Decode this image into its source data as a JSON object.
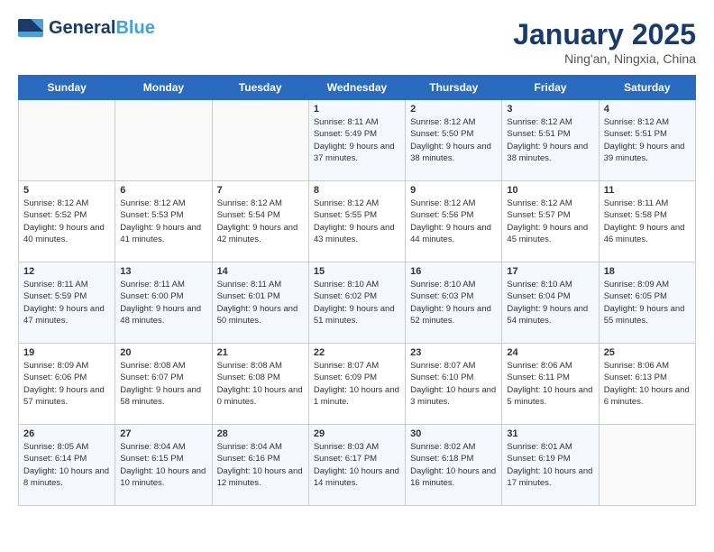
{
  "logo": {
    "brand1": "General",
    "brand2": "Blue",
    "icon": "▶"
  },
  "title": "January 2025",
  "subtitle": "Ning'an, Ningxia, China",
  "days_of_week": [
    "Sunday",
    "Monday",
    "Tuesday",
    "Wednesday",
    "Thursday",
    "Friday",
    "Saturday"
  ],
  "weeks": [
    [
      {
        "day": "",
        "info": ""
      },
      {
        "day": "",
        "info": ""
      },
      {
        "day": "",
        "info": ""
      },
      {
        "day": "1",
        "info": "Sunrise: 8:11 AM\nSunset: 5:49 PM\nDaylight: 9 hours and 37 minutes."
      },
      {
        "day": "2",
        "info": "Sunrise: 8:12 AM\nSunset: 5:50 PM\nDaylight: 9 hours and 38 minutes."
      },
      {
        "day": "3",
        "info": "Sunrise: 8:12 AM\nSunset: 5:51 PM\nDaylight: 9 hours and 38 minutes."
      },
      {
        "day": "4",
        "info": "Sunrise: 8:12 AM\nSunset: 5:51 PM\nDaylight: 9 hours and 39 minutes."
      }
    ],
    [
      {
        "day": "5",
        "info": "Sunrise: 8:12 AM\nSunset: 5:52 PM\nDaylight: 9 hours and 40 minutes."
      },
      {
        "day": "6",
        "info": "Sunrise: 8:12 AM\nSunset: 5:53 PM\nDaylight: 9 hours and 41 minutes."
      },
      {
        "day": "7",
        "info": "Sunrise: 8:12 AM\nSunset: 5:54 PM\nDaylight: 9 hours and 42 minutes."
      },
      {
        "day": "8",
        "info": "Sunrise: 8:12 AM\nSunset: 5:55 PM\nDaylight: 9 hours and 43 minutes."
      },
      {
        "day": "9",
        "info": "Sunrise: 8:12 AM\nSunset: 5:56 PM\nDaylight: 9 hours and 44 minutes."
      },
      {
        "day": "10",
        "info": "Sunrise: 8:12 AM\nSunset: 5:57 PM\nDaylight: 9 hours and 45 minutes."
      },
      {
        "day": "11",
        "info": "Sunrise: 8:11 AM\nSunset: 5:58 PM\nDaylight: 9 hours and 46 minutes."
      }
    ],
    [
      {
        "day": "12",
        "info": "Sunrise: 8:11 AM\nSunset: 5:59 PM\nDaylight: 9 hours and 47 minutes."
      },
      {
        "day": "13",
        "info": "Sunrise: 8:11 AM\nSunset: 6:00 PM\nDaylight: 9 hours and 48 minutes."
      },
      {
        "day": "14",
        "info": "Sunrise: 8:11 AM\nSunset: 6:01 PM\nDaylight: 9 hours and 50 minutes."
      },
      {
        "day": "15",
        "info": "Sunrise: 8:10 AM\nSunset: 6:02 PM\nDaylight: 9 hours and 51 minutes."
      },
      {
        "day": "16",
        "info": "Sunrise: 8:10 AM\nSunset: 6:03 PM\nDaylight: 9 hours and 52 minutes."
      },
      {
        "day": "17",
        "info": "Sunrise: 8:10 AM\nSunset: 6:04 PM\nDaylight: 9 hours and 54 minutes."
      },
      {
        "day": "18",
        "info": "Sunrise: 8:09 AM\nSunset: 6:05 PM\nDaylight: 9 hours and 55 minutes."
      }
    ],
    [
      {
        "day": "19",
        "info": "Sunrise: 8:09 AM\nSunset: 6:06 PM\nDaylight: 9 hours and 57 minutes."
      },
      {
        "day": "20",
        "info": "Sunrise: 8:08 AM\nSunset: 6:07 PM\nDaylight: 9 hours and 58 minutes."
      },
      {
        "day": "21",
        "info": "Sunrise: 8:08 AM\nSunset: 6:08 PM\nDaylight: 10 hours and 0 minutes."
      },
      {
        "day": "22",
        "info": "Sunrise: 8:07 AM\nSunset: 6:09 PM\nDaylight: 10 hours and 1 minute."
      },
      {
        "day": "23",
        "info": "Sunrise: 8:07 AM\nSunset: 6:10 PM\nDaylight: 10 hours and 3 minutes."
      },
      {
        "day": "24",
        "info": "Sunrise: 8:06 AM\nSunset: 6:11 PM\nDaylight: 10 hours and 5 minutes."
      },
      {
        "day": "25",
        "info": "Sunrise: 8:06 AM\nSunset: 6:13 PM\nDaylight: 10 hours and 6 minutes."
      }
    ],
    [
      {
        "day": "26",
        "info": "Sunrise: 8:05 AM\nSunset: 6:14 PM\nDaylight: 10 hours and 8 minutes."
      },
      {
        "day": "27",
        "info": "Sunrise: 8:04 AM\nSunset: 6:15 PM\nDaylight: 10 hours and 10 minutes."
      },
      {
        "day": "28",
        "info": "Sunrise: 8:04 AM\nSunset: 6:16 PM\nDaylight: 10 hours and 12 minutes."
      },
      {
        "day": "29",
        "info": "Sunrise: 8:03 AM\nSunset: 6:17 PM\nDaylight: 10 hours and 14 minutes."
      },
      {
        "day": "30",
        "info": "Sunrise: 8:02 AM\nSunset: 6:18 PM\nDaylight: 10 hours and 16 minutes."
      },
      {
        "day": "31",
        "info": "Sunrise: 8:01 AM\nSunset: 6:19 PM\nDaylight: 10 hours and 17 minutes."
      },
      {
        "day": "",
        "info": ""
      }
    ]
  ]
}
